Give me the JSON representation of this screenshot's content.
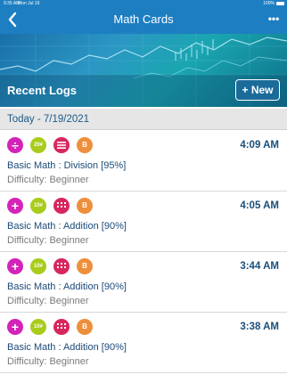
{
  "status_bar": {
    "time": "9:35 AM",
    "date": "Mon Jul 19",
    "battery": "100%"
  },
  "nav": {
    "title": "Math Cards",
    "more_label": "•••"
  },
  "banner": {
    "title": "Recent Logs",
    "new_button_label": "+ New"
  },
  "section": {
    "header": "Today - 7/19/2021"
  },
  "logs": [
    {
      "op_symbol": "÷",
      "op_icon": "divide-icon",
      "count_badge": "20#",
      "grid_icon": "list-icon",
      "level_badge": "B",
      "time": "4:09 AM",
      "title": "Basic Math : Division [95%]",
      "difficulty": "Difficulty: Beginner"
    },
    {
      "op_symbol": "+",
      "op_icon": "plus-icon",
      "count_badge": "10#",
      "grid_icon": "grid-icon",
      "level_badge": "B",
      "time": "4:05 AM",
      "title": "Basic Math : Addition [90%]",
      "difficulty": "Difficulty: Beginner"
    },
    {
      "op_symbol": "+",
      "op_icon": "plus-icon",
      "count_badge": "10#",
      "grid_icon": "grid-icon",
      "level_badge": "B",
      "time": "3:44 AM",
      "title": "Basic Math : Addition [90%]",
      "difficulty": "Difficulty: Beginner"
    },
    {
      "op_symbol": "+",
      "op_icon": "plus-icon",
      "count_badge": "10#",
      "grid_icon": "grid-icon",
      "level_badge": "B",
      "time": "3:38 AM",
      "title": "Basic Math : Addition [90%]",
      "difficulty": "Difficulty: Beginner"
    }
  ],
  "colors": {
    "header_blue": "#1d7fc2",
    "operation_magenta": "#d423b8",
    "count_green": "#a8cc1c",
    "grid_red": "#d8265e",
    "level_orange": "#ee8f3c",
    "title_navy": "#1b4a78"
  }
}
